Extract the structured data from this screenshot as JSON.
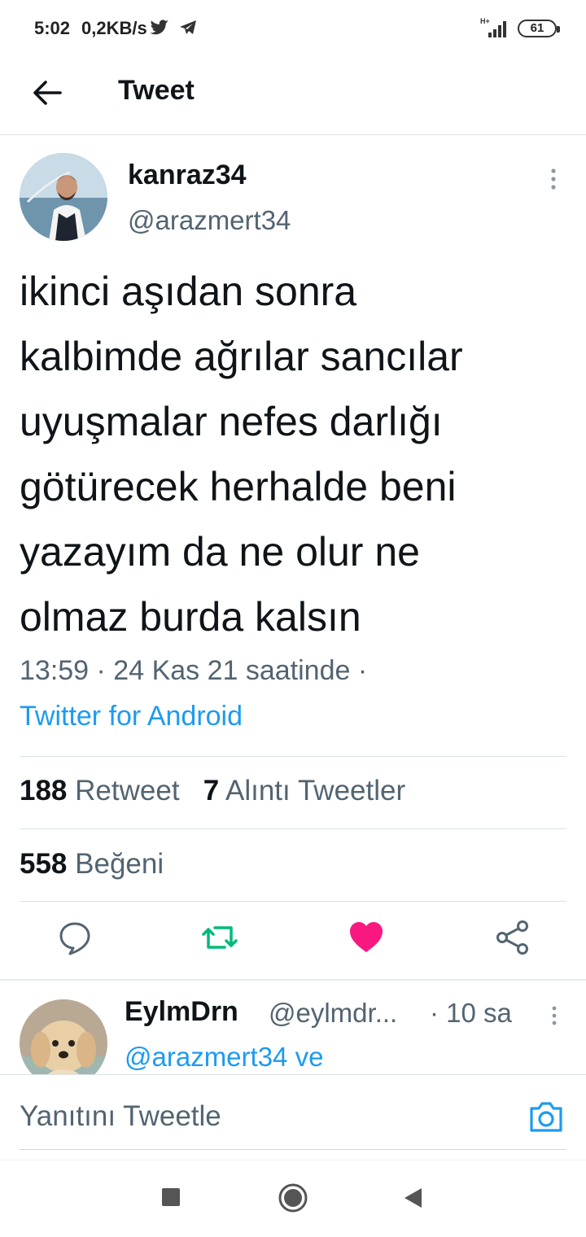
{
  "status_bar": {
    "time": "5:02",
    "speed": "0,2KB/s",
    "battery": "61",
    "signal_label": "H+"
  },
  "header": {
    "title": "Tweet"
  },
  "tweet": {
    "display_name": "kanraz34",
    "handle": "@arazmert34",
    "text": "ikinci aşıdan sonra\nkalbimde ağrılar sancılar\nuyuşmalar nefes darlığı\ngötürecek herhalde beni\nyazayım da ne olur ne\nolmaz burda kalsın",
    "timestamp": "13:59 · 24 Kas 21 saatinde ·",
    "source": "Twitter for Android",
    "retweet_count": "188",
    "retweet_label": "Retweet",
    "quote_count": "7",
    "quote_label": "Alıntı Tweetler",
    "like_count": "558",
    "like_label": "Beğeni"
  },
  "reply": {
    "display_name": "EylmDrn",
    "handle": "@eylmdr...",
    "time": "· 10 sa",
    "mention": "@arazmert34 ve"
  },
  "compose": {
    "placeholder": "Yanıtını Tweetle"
  },
  "colors": {
    "accent": "#1d9bf0",
    "retweet": "#00ba7c",
    "like": "#f91880",
    "secondary_text": "#536471"
  }
}
